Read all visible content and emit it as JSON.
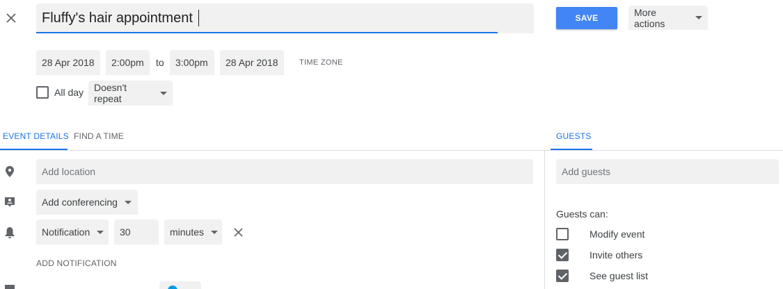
{
  "header": {
    "title_value": "Fluffy's hair appointment",
    "save_label": "SAVE",
    "more_actions_label": "More actions"
  },
  "datetime": {
    "start_date": "28 Apr 2018",
    "start_time": "2:00pm",
    "to_label": "to",
    "end_time": "3:00pm",
    "end_date": "28 Apr 2018",
    "time_zone_label": "TIME ZONE"
  },
  "options": {
    "all_day_label": "All day",
    "repeat_label": "Doesn't repeat"
  },
  "tabs": {
    "event_details": "EVENT DETAILS",
    "find_a_time": "FIND A TIME",
    "guests": "GUESTS"
  },
  "details": {
    "location_placeholder": "Add location",
    "conferencing_label": "Add conferencing",
    "notification_type": "Notification",
    "notification_value": "30",
    "notification_unit": "minutes",
    "add_notification_label": "ADD NOTIFICATION"
  },
  "guests": {
    "add_guests_placeholder": "Add guests",
    "guests_can_label": "Guests can:",
    "permissions": [
      {
        "label": "Modify event",
        "checked": false
      },
      {
        "label": "Invite others",
        "checked": true
      },
      {
        "label": "See guest list",
        "checked": true
      }
    ]
  },
  "colors": {
    "accent": "#1a73e8",
    "save_button": "#4285f4",
    "field_bg": "#f1f1f1"
  }
}
